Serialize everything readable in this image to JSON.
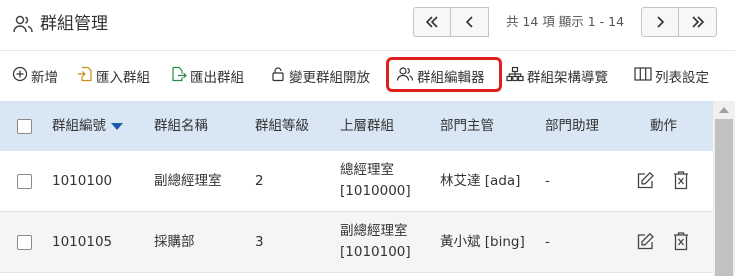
{
  "header": {
    "title": "群組管理",
    "title_icon": "users-icon",
    "pager": {
      "info": "共 14 項 顯示 1 - 14",
      "first_icon": "double-chevron-left-icon",
      "prev_icon": "chevron-left-icon",
      "next_icon": "chevron-right-icon",
      "last_icon": "double-chevron-right-icon"
    }
  },
  "toolbar": {
    "items": [
      {
        "label": "新增",
        "icon": "plus-circle-icon"
      },
      {
        "label": "匯入群組",
        "icon": "import-file-icon"
      },
      {
        "label": "匯出群組",
        "icon": "export-file-icon"
      },
      {
        "label": "變更群組開放",
        "icon": "lock-icon"
      },
      {
        "label": "群組編輯器",
        "icon": "users-icon"
      },
      {
        "label": "群組架構導覽",
        "icon": "org-chart-icon"
      },
      {
        "label": "列表設定",
        "icon": "columns-icon"
      }
    ],
    "highlight_color": "#e02020"
  },
  "table": {
    "columns": [
      "群組編號",
      "群組名稱",
      "群組等級",
      "上層群組",
      "部門主管",
      "部門助理",
      "動作"
    ],
    "sort_column": "群組編號",
    "rows": [
      {
        "id": "1010100",
        "name": "副總經理室",
        "level": "2",
        "parent_line1": "總經理室",
        "parent_line2": "[1010000]",
        "manager": "林艾達 [ada]",
        "assistant": "-"
      },
      {
        "id": "1010105",
        "name": "採購部",
        "level": "3",
        "parent_line1": "副總經理室",
        "parent_line2": "[1010100]",
        "manager": "黃小斌 [bing]",
        "assistant": "-"
      }
    ]
  },
  "colors": {
    "header_bg": "#d9e7f5",
    "sort_arrow": "#1e5aa8",
    "alt_row": "#f5f5f5"
  }
}
